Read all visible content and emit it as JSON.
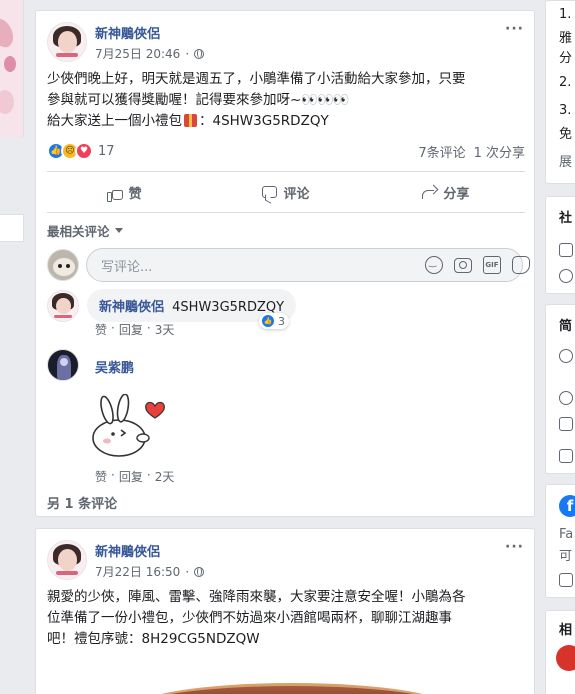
{
  "post1": {
    "author": "新神鵰俠侶",
    "date": "7月25日 20:46",
    "more": "···",
    "lines": [
      "少俠們晚上好，明天就是週五了，小鵰準備了小活動給大家參加，只要",
      "參與就可以獲得獎勵喔！記得要來參加呀~",
      "給大家送上一個小禮包"
    ],
    "eyes": "👀👀👀",
    "code_line_suffix": "：4SHW3G5RDZQY",
    "reactions": {
      "icons": [
        "like-reaction",
        "sad-reaction",
        "love-reaction"
      ],
      "count": "17",
      "comments": "7条评论",
      "shares": "1 次分享"
    },
    "actions": {
      "like": "赞",
      "comment": "评论",
      "share": "分享"
    },
    "sort_label": "最相关评论",
    "composer_placeholder": "写评论...",
    "comments": [
      {
        "author": "新神鵰俠侶",
        "text": "4SHW3G5RDZQY",
        "like": "赞",
        "reply": "回复",
        "time": "3天",
        "reaction_count": "3"
      },
      {
        "author": "吴紫鹏",
        "like": "赞",
        "reply": "回复",
        "time": "2天",
        "sticker": "rabbit-heart-sticker"
      }
    ],
    "more_comments": "另 1 条评论"
  },
  "post2": {
    "author": "新神鵰俠侶",
    "date": "7月22日 16:50",
    "more": "···",
    "lines": [
      "親愛的少俠，陣風、雷擊、強降雨來襲，大家要注意安全喔！小鵰為各",
      "位準備了一份小禮包，少俠們不妨過來小酒館喝兩杯，聊聊江湖趣事",
      "吧！禮包序號：8H29CG5NDZQW"
    ]
  },
  "right_rail": {
    "a": [
      "1.",
      "雅",
      "分",
      "2.",
      "3.",
      "免",
      "展"
    ],
    "b_title": "社",
    "c_title": "简",
    "d_lines": [
      "Fa",
      "可"
    ],
    "e_title": "相"
  },
  "colors": {
    "link_blue": "#385898",
    "fb_blue": "#1877f2",
    "secondary": "#606770",
    "background": "#e9ebee"
  }
}
